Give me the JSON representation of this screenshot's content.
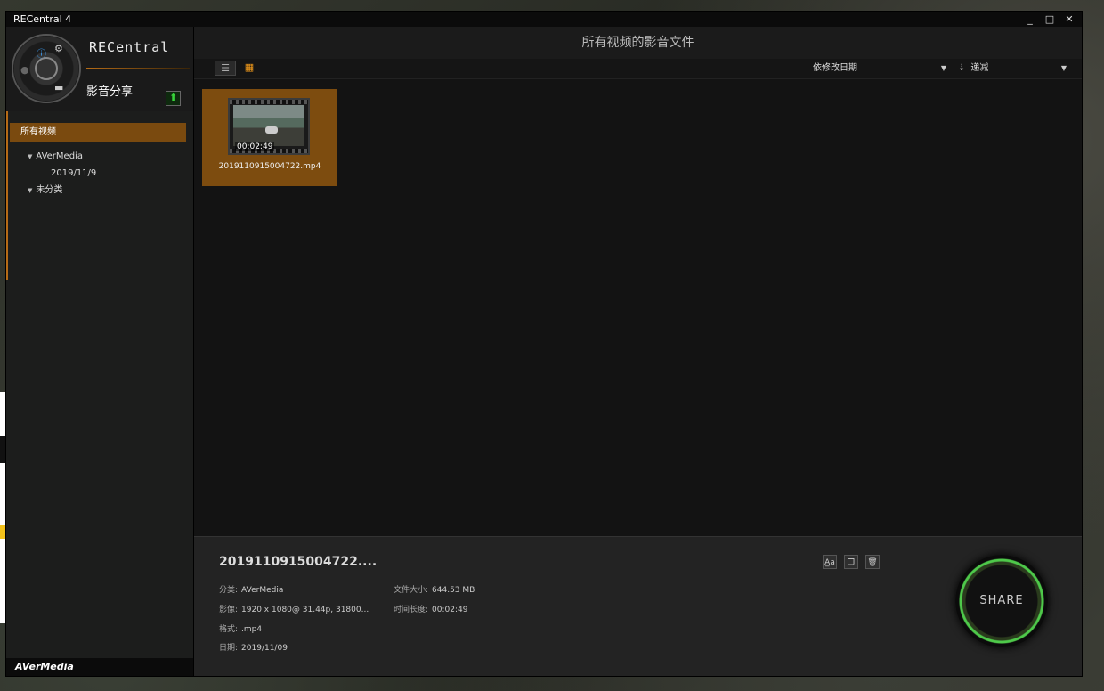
{
  "window": {
    "title": "RECentral 4",
    "controls": [
      "_",
      "□",
      "✕"
    ]
  },
  "sidebar": {
    "brand": "RECentral",
    "section": "影音分享",
    "nav": [
      {
        "label": "所有视频",
        "level": 0,
        "active": true
      },
      {
        "label": "AVerMedia",
        "level": 1,
        "expandable": true
      },
      {
        "label": "2019/11/9",
        "level": 2
      },
      {
        "label": "未分类",
        "level": 1,
        "expandable": true
      }
    ],
    "footer": "AVerMedia",
    "icons": [
      "info-icon",
      "gear-icon",
      "folder-icon",
      "upload-icon"
    ]
  },
  "main": {
    "title": "所有视频的影音文件",
    "sort_label": "依修改日期",
    "order_label": "递减",
    "files": [
      {
        "name": "2019110915004722.mp4",
        "duration": "00:02:49"
      }
    ]
  },
  "details": {
    "title": "2019110915004722....",
    "category_label": "分类:",
    "category": "AVerMedia",
    "video_label": "影像:",
    "video": "1920 x 1080@ 31.44p, 31800...",
    "format_label": "格式:",
    "format": ".mp4",
    "date_label": "日期:",
    "date": "2019/11/09",
    "size_label": "文件大小:",
    "size": "644.53 MB",
    "duration_label": "时间长度:",
    "duration": "00:02:49",
    "share_label": "SHARE"
  },
  "colors": {
    "accent": "#7a4a0f",
    "grid_icon": "#f29a1a",
    "share_ring": "#4ec94a"
  }
}
